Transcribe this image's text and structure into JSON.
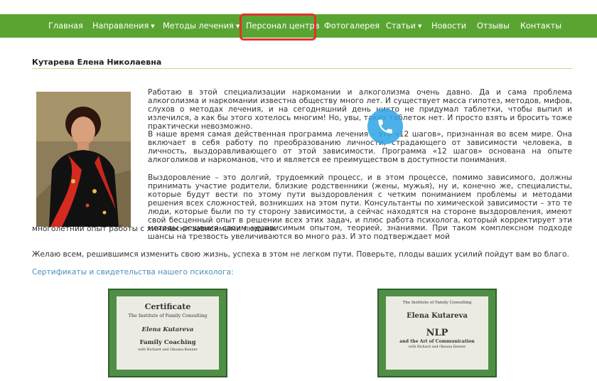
{
  "nav": {
    "items": [
      {
        "label": "Главная",
        "dropdown": false
      },
      {
        "label": "Направления",
        "dropdown": true
      },
      {
        "label": "Методы лечения",
        "dropdown": true
      },
      {
        "label": "Персонал центра",
        "dropdown": false,
        "active": true
      },
      {
        "label": "Фотогалерея",
        "dropdown": false
      },
      {
        "label": "Статьи",
        "dropdown": true
      },
      {
        "label": "Новости",
        "dropdown": false
      },
      {
        "label": "Отзывы",
        "dropdown": false
      },
      {
        "label": "Контакты",
        "dropdown": false
      }
    ],
    "caret_glyph": "▼"
  },
  "page": {
    "title": "Кутарева Елена Николаевна",
    "paragraphs": [
      "Работаю в этой специализации наркомании и алкоголизма очень давно. Да и сама проблема алкоголизма и наркомании известна обществу много лет. И существует масса гипотез, методов, мифов, слухов о методах лечения, и на сегодняшний день никто не придумал таблетки, чтобы выпил и излечился, а как бы этого хотелось многим! Но, увы, таких таблеток нет. И просто взять и бросить тоже практически невозможно.",
      "В наше время самая действенная программа лечения – это «12 шагов», признанная во всем мире. Она включает в себя работу по преобразованию личности, страдающего от зависимости человека, в личность, выздоравливающего от этой зависимости. Программа «12 шагов» основана на опыте алкоголиков и наркоманов, что и является ее преимуществом в доступности понимания.",
      "Выздоровление – это долгий, трудоемкий процесс, и в этом процессе, помимо зависимого, должны принимать участие родители, близкие родственники (жены, мужья), ну и, конечно же, специалисты, которые будут вести по этому пути выздоровления с четким пониманием проблемы и методами решения всех сложностей, возникших на этом пути. Консультанты по химической зависимости – это те люди, которые были по ту сторону зависимости, а сейчас находятся на стороне выздоровления, имеют свой бесценный опыт в решении всех этих задач, и плюс работа психолога, который корректирует эти методы решения своим независимым опытом, теорией, знаниями. При таком комплексном подходе шансы на трезвость увеличиваются во много раз. И это подтверждает мой",
      "многолетний опыт работы с химически зависимыми людьми.",
      "Желаю всем, решившимся изменить свою жизнь, успеха в этом не легком пути. Поверьте, плоды ваших усилий пойдут вам во благо."
    ],
    "certificates_link": "Сертификаты и свидетельства нашего психолога:"
  },
  "certificates": [
    {
      "heading": "Certificate",
      "org": "The Institute of Family Consulting",
      "name": "Elena Kutareva",
      "course": "Family Coaching",
      "teachers": "with Richard and Oksana Kenner"
    },
    {
      "org": "The Institute of Family Consulting",
      "name": "Elena Kutareva",
      "course": "NLP",
      "course2": "and the Art of Communication",
      "teachers": "with Richard and Oksana Kenner"
    }
  ],
  "icons": {
    "photo": "portrait-photo",
    "call": "phone-icon"
  },
  "colors": {
    "nav_bg": "#5aa532",
    "active_outline": "#e0332c",
    "link": "#4a8fc0",
    "call_button": "#34a7e6",
    "cert_frame": "#4f8f45"
  }
}
